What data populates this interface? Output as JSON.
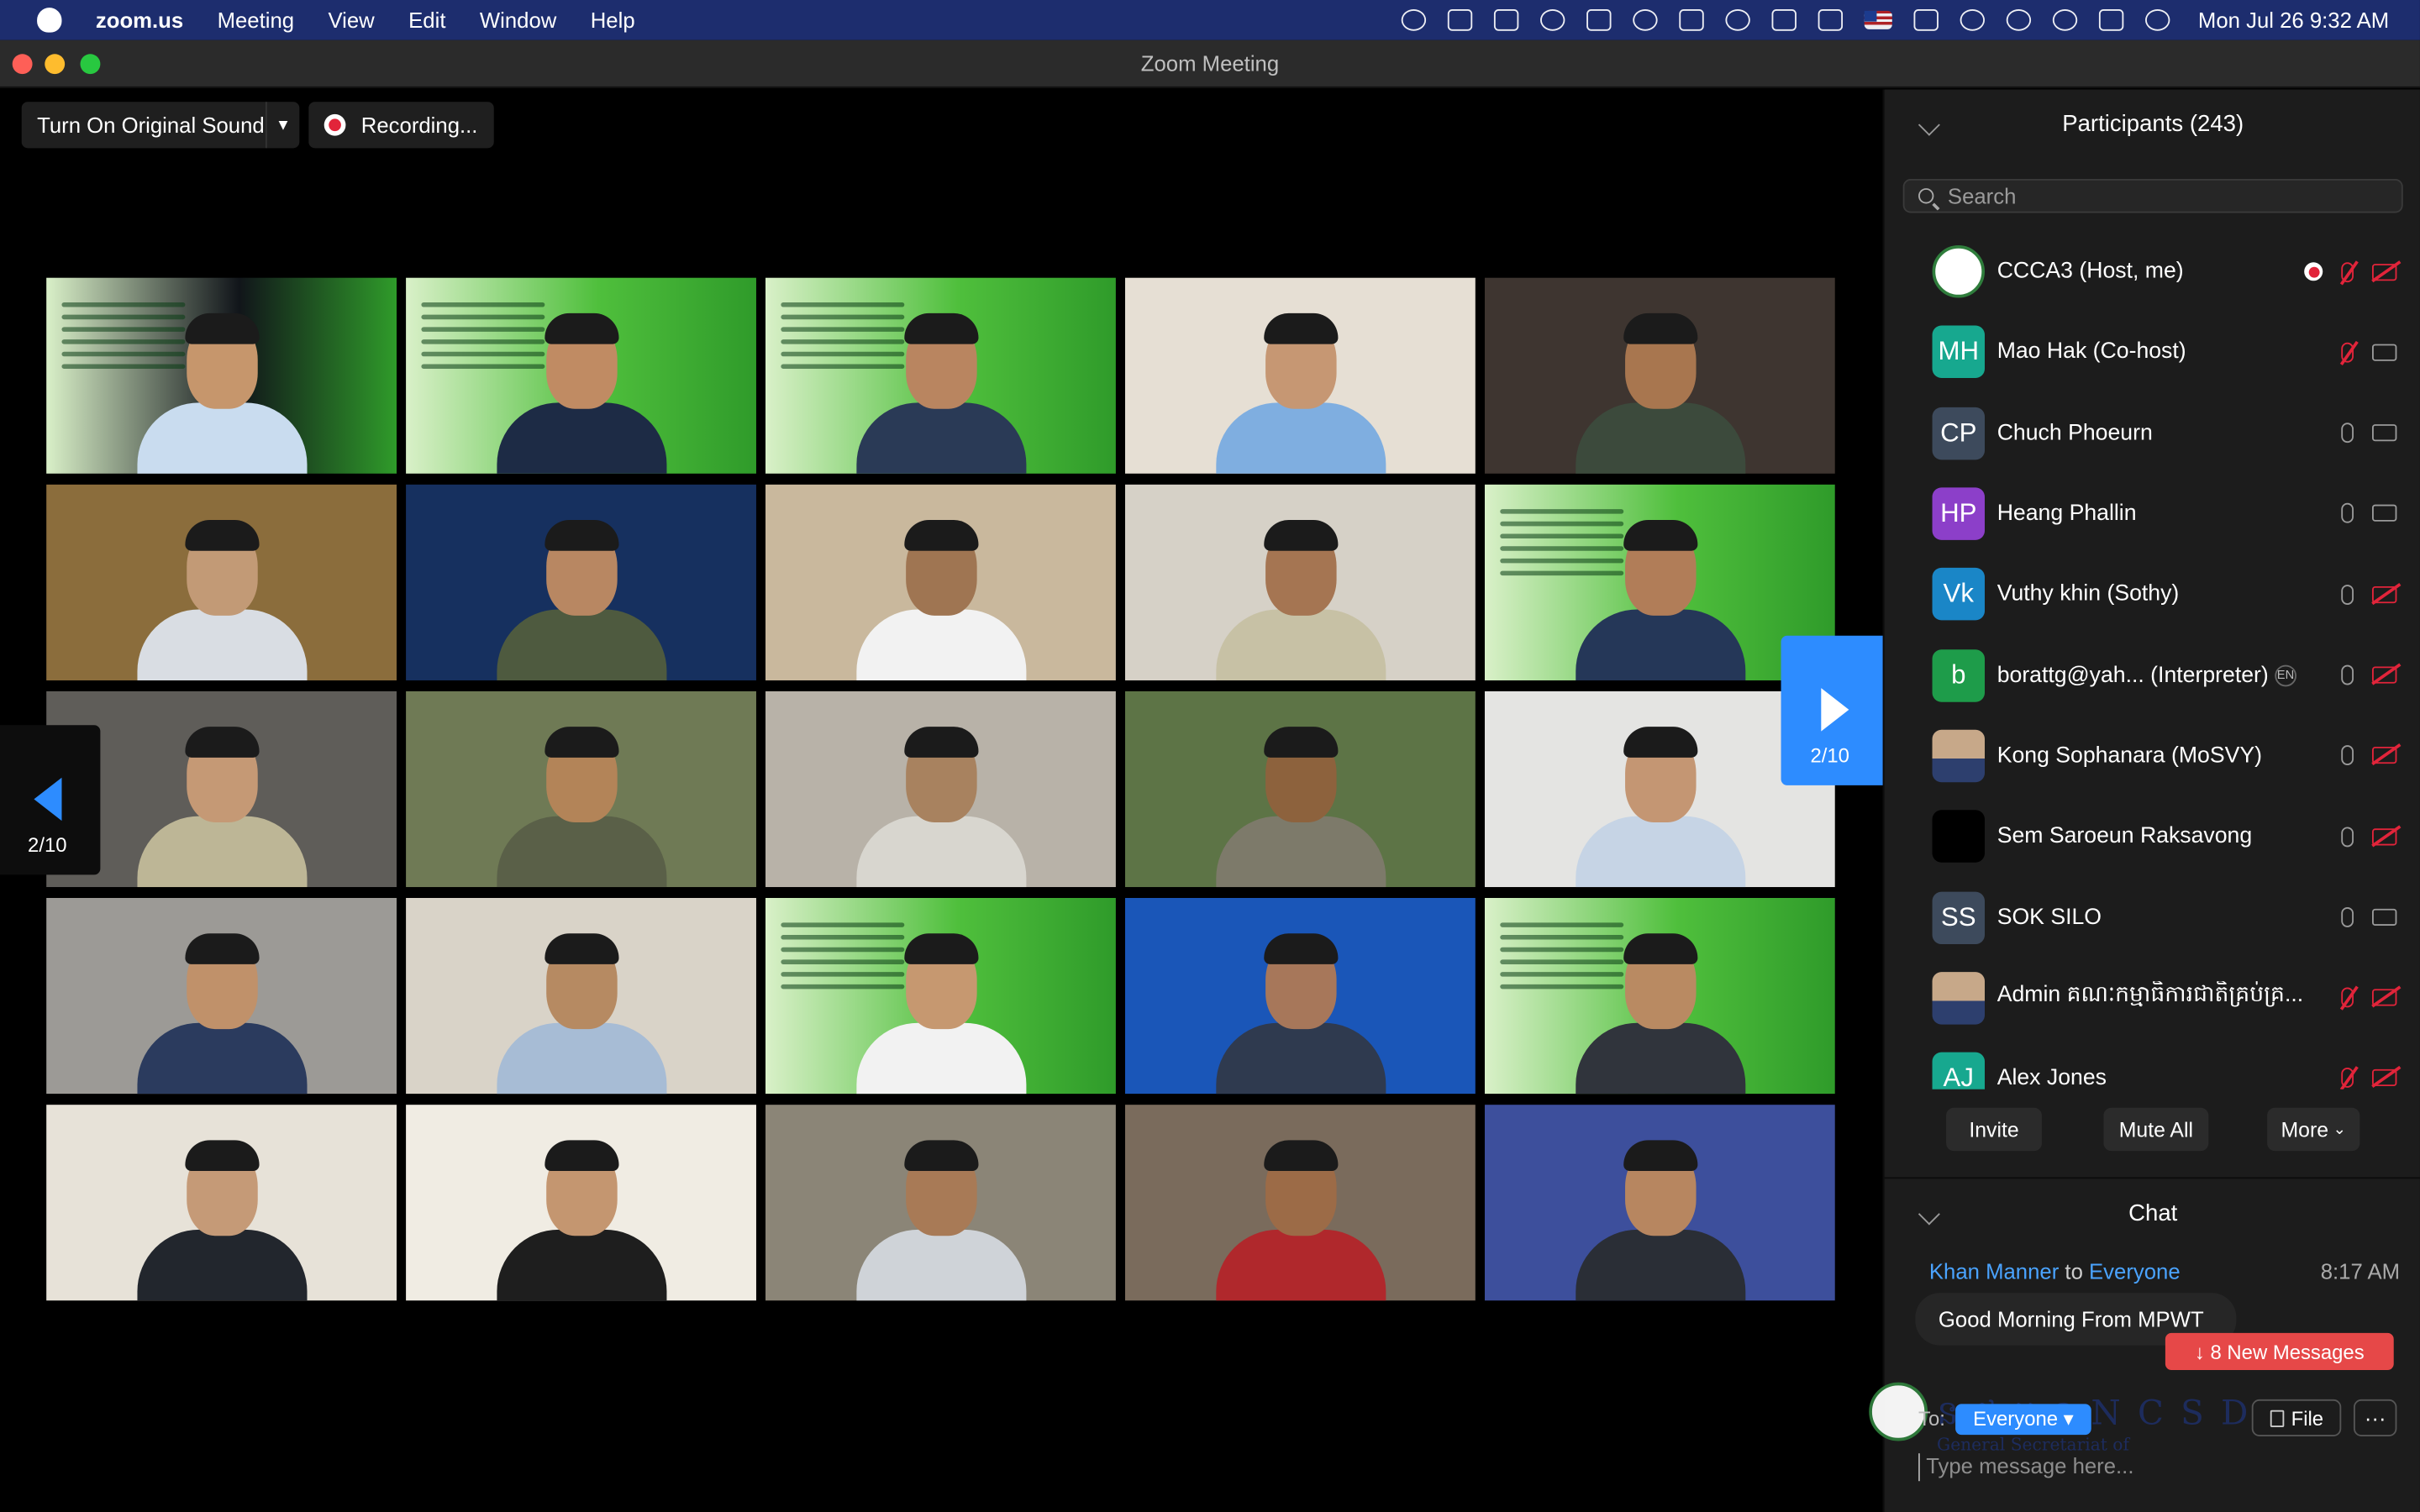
{
  "menubar": {
    "app": "zoom.us",
    "items": [
      "Meeting",
      "View",
      "Edit",
      "Window",
      "Help"
    ],
    "clock": "Mon Jul 26  9:32 AM"
  },
  "window": {
    "title": "Zoom Meeting"
  },
  "toolbar": {
    "sound_label": "Turn On Original Sound",
    "recording_label": "Recording..."
  },
  "gallery": {
    "page_indicator": "2/10",
    "tiles": [
      {
        "bg": "#11151a",
        "face": "#c6966c",
        "shirt": "#c9dcef",
        "banner": true
      },
      {
        "bg": "#4fbf3c",
        "face": "#c08b63",
        "shirt": "#1d2b45",
        "banner": true
      },
      {
        "bg": "#4fbf3c",
        "face": "#b98560",
        "shirt": "#2a3a56",
        "banner": true
      },
      {
        "bg": "#e6dfd4",
        "face": "#c69773",
        "shirt": "#7faee0",
        "banner": false
      },
      {
        "bg": "#3e3530",
        "face": "#a8764f",
        "shirt": "#3c4a3c",
        "banner": false
      },
      {
        "bg": "#8b6d3c",
        "face": "#c29a76",
        "shirt": "#d9dde3",
        "banner": false
      },
      {
        "bg": "#16305f",
        "face": "#b88762",
        "shirt": "#4e5a3f",
        "banner": false
      },
      {
        "bg": "#c9b89d",
        "face": "#9f7552",
        "shirt": "#f2f2f2",
        "banner": false
      },
      {
        "bg": "#d6d1c7",
        "face": "#a57552",
        "shirt": "#c7c1a5",
        "banner": false
      },
      {
        "bg": "#4fbf3c",
        "face": "#b17d58",
        "shirt": "#253758",
        "banner": true
      },
      {
        "bg": "#5f5d59",
        "face": "#c59975",
        "shirt": "#bdb696",
        "banner": false
      },
      {
        "bg": "#6f7a55",
        "face": "#b38458",
        "shirt": "#5a6048",
        "banner": false
      },
      {
        "bg": "#b8b2a8",
        "face": "#a8825f",
        "shirt": "#d8d6cf",
        "banner": false
      },
      {
        "bg": "#5d7446",
        "face": "#8d623d",
        "shirt": "#7d7a6a",
        "banner": false
      },
      {
        "bg": "#e4e4e2",
        "face": "#c49673",
        "shirt": "#c6d4e5",
        "banner": false
      },
      {
        "bg": "#9c9a96",
        "face": "#c0916a",
        "shirt": "#2b3b5e",
        "banner": false
      },
      {
        "bg": "#d9d3c8",
        "face": "#b68a62",
        "shirt": "#a7bcd5",
        "banner": false
      },
      {
        "bg": "#4fbf3c",
        "face": "#c69870",
        "shirt": "#f2f2f2",
        "banner": true
      },
      {
        "bg": "#1a56b8",
        "face": "#a7775a",
        "shirt": "#2f3a4f",
        "banner": false
      },
      {
        "bg": "#4fbf3c",
        "face": "#b98a62",
        "shirt": "#30343c",
        "banner": true
      },
      {
        "bg": "#e7e2d8",
        "face": "#c59a77",
        "shirt": "#22262d",
        "banner": false
      },
      {
        "bg": "#f0ece3",
        "face": "#c49670",
        "shirt": "#1e1e1e",
        "banner": false
      },
      {
        "bg": "#8b8577",
        "face": "#a87a56",
        "shirt": "#cfd3d8",
        "banner": false
      },
      {
        "bg": "#7a6b5c",
        "face": "#9c6b47",
        "shirt": "#b0282c",
        "banner": false
      },
      {
        "bg": "#3d4f9c",
        "face": "#b78660",
        "shirt": "#2a2e36",
        "banner": false
      }
    ]
  },
  "participants": {
    "title": "Participants (243)",
    "search_placeholder": "Search",
    "list": [
      {
        "initials": "",
        "avatar": "logo",
        "color": "#ffffff",
        "name": "CCCA3 (Host, me)",
        "rec": true,
        "mic": "muted",
        "cam": "off"
      },
      {
        "initials": "MH",
        "avatar": "initials",
        "color": "#17a88f",
        "name": "Mao Hak (Co-host)",
        "rec": false,
        "mic": "muted",
        "cam": "on"
      },
      {
        "initials": "CP",
        "avatar": "initials",
        "color": "#3d4a5c",
        "name": "Chuch Phoeurn",
        "rec": false,
        "mic": "on",
        "cam": "on"
      },
      {
        "initials": "HP",
        "avatar": "initials",
        "color": "#8c3fc9",
        "name": "Heang Phallin",
        "rec": false,
        "mic": "on",
        "cam": "on"
      },
      {
        "initials": "Vk",
        "avatar": "initials",
        "color": "#1a86c7",
        "name": "Vuthy khin (Sothy)",
        "rec": false,
        "mic": "on",
        "cam": "off"
      },
      {
        "initials": "b",
        "avatar": "initials",
        "color": "#1e9c4a",
        "name": "borattg@yah... (Interpreter)",
        "badge": "EN",
        "rec": false,
        "mic": "on",
        "cam": "off"
      },
      {
        "initials": "",
        "avatar": "photo",
        "color": "#c7a889",
        "name": "Kong Sophanara (MoSVY)",
        "rec": false,
        "mic": "on",
        "cam": "off"
      },
      {
        "initials": "",
        "avatar": "black",
        "color": "#000000",
        "name": "Sem Saroeun Raksavong",
        "rec": false,
        "mic": "on",
        "cam": "off"
      },
      {
        "initials": "SS",
        "avatar": "initials",
        "color": "#3d4a5c",
        "name": "SOK SILO",
        "rec": false,
        "mic": "on",
        "cam": "on"
      },
      {
        "initials": "",
        "avatar": "photo",
        "color": "#c7a889",
        "name": "Admin គណៈកម្មាធិការជាតិគ្រប់គ្រ...",
        "rec": false,
        "mic": "muted",
        "cam": "off"
      },
      {
        "initials": "AJ",
        "avatar": "initials",
        "color": "#17a88f",
        "name": "Alex Jones",
        "rec": false,
        "mic": "muted",
        "cam": "off"
      }
    ],
    "actions": {
      "invite": "Invite",
      "mute_all": "Mute All",
      "more": "More"
    }
  },
  "chat": {
    "title": "Chat",
    "message": {
      "sender": "Khan Manner",
      "to": "to",
      "target": "Everyone",
      "time": "8:17 AM",
      "text": "Good Morning From MPWT"
    },
    "new_messages": "↓ 8 New Messages",
    "to_label": "To:",
    "to_value": "Everyone ▾",
    "file_label": "File",
    "more_label": "···",
    "input_placeholder": "Type message here...",
    "watermark": "ន.ជ.អ.ន  N C S D",
    "watermark_sub": "General Secretariat of"
  }
}
